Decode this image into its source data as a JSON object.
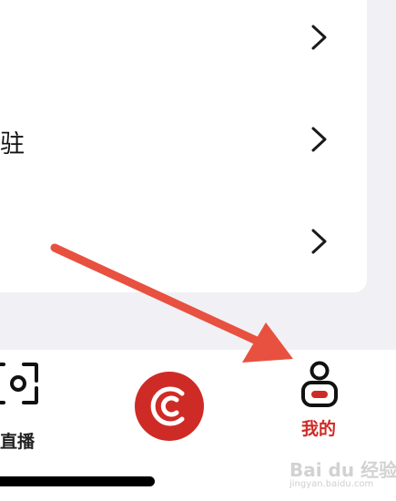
{
  "list": {
    "rows": [
      {
        "label": ""
      },
      {
        "label": "驻"
      },
      {
        "label": ""
      }
    ]
  },
  "tabbar": {
    "tabs": [
      {
        "label": "直播",
        "icon": "live-scan-icon"
      },
      {
        "label": "",
        "icon": "center-record-icon"
      },
      {
        "label": "我的",
        "icon": "profile-icon"
      }
    ],
    "active_color": "#cf2b26"
  },
  "annotation": {
    "color": "#e8513f"
  },
  "watermark": {
    "main": "Bai du 经验",
    "sub": "jingyan.baidu.com"
  }
}
